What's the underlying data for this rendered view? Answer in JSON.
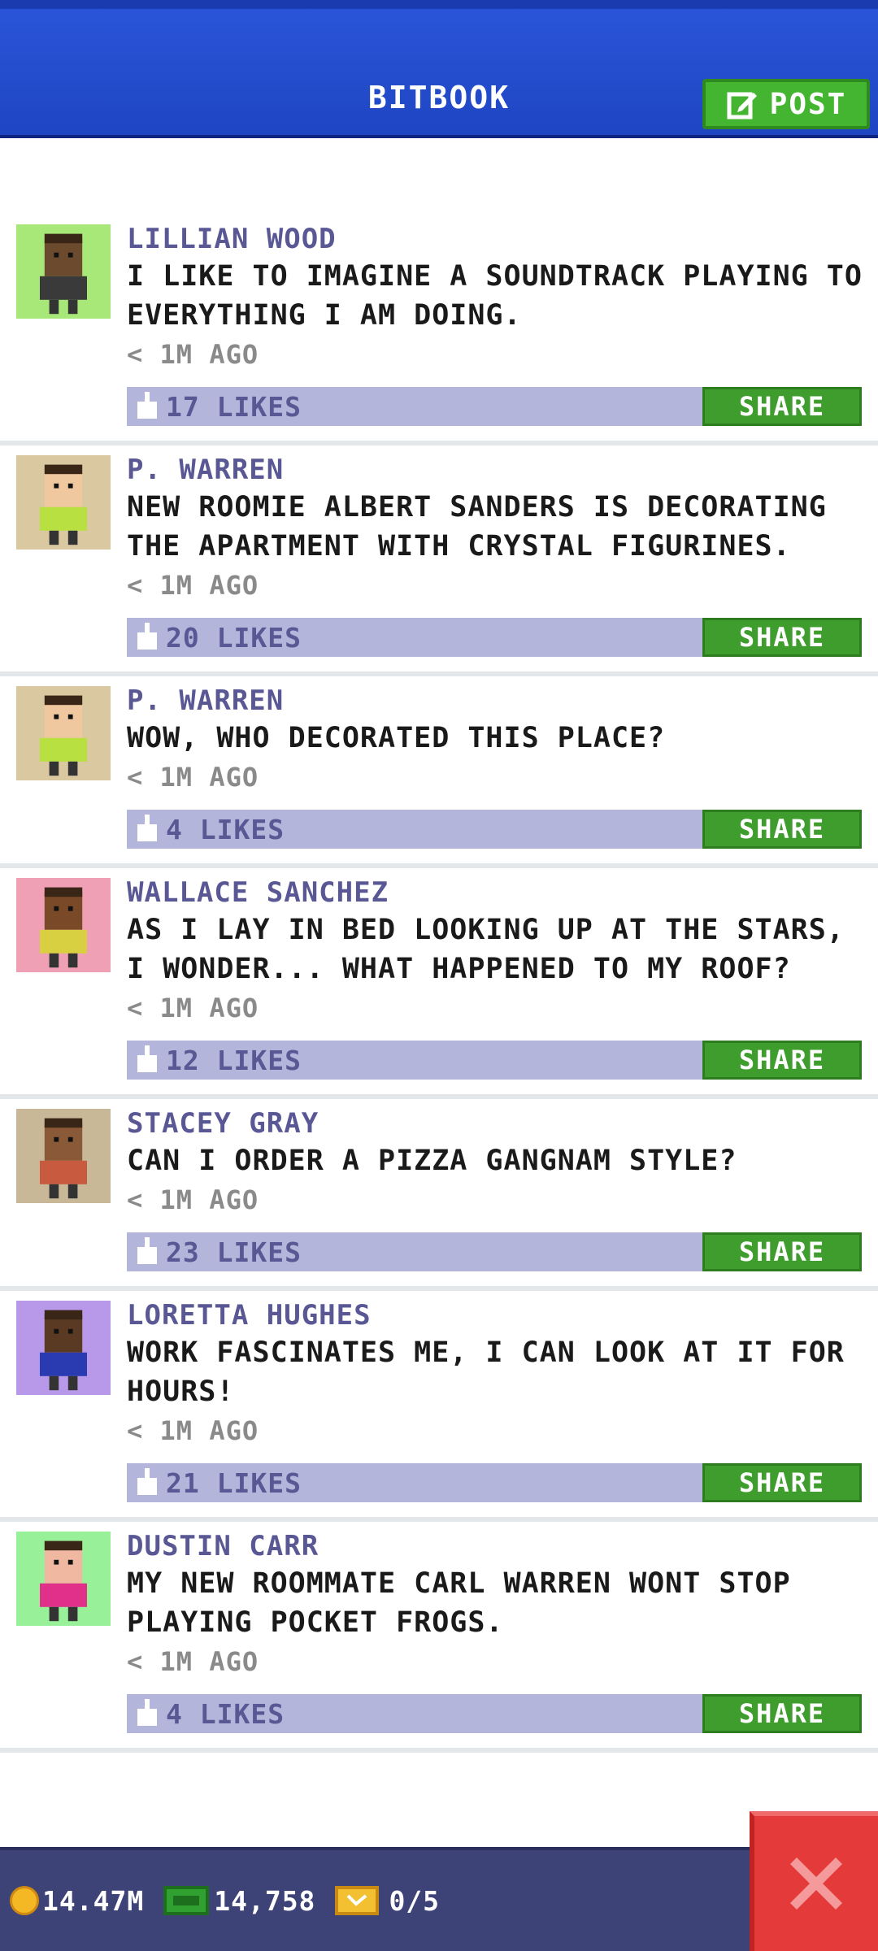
{
  "header": {
    "title": "BITBOOK",
    "post_label": "POST"
  },
  "posts": [
    {
      "author": "LILLIAN WOOD",
      "text": "I LIKE TO IMAGINE A SOUNDTRACK PLAYING TO EVERYTHING I AM DOING.",
      "time": "< 1M AGO",
      "likes": "17 LIKES",
      "share": "SHARE",
      "avatar_bg": "#a8e878",
      "skin": "#6b4a2e",
      "shirt": "#3a3a3a"
    },
    {
      "author": "P. WARREN",
      "text": "NEW ROOMIE ALBERT SANDERS IS DECORATING THE APARTMENT WITH CRYSTAL FIGURINES.",
      "time": "< 1M AGO",
      "likes": "20 LIKES",
      "share": "SHARE",
      "avatar_bg": "#d9c8a0",
      "skin": "#f0c8a0",
      "shirt": "#b8e040"
    },
    {
      "author": "P. WARREN",
      "text": "WOW, WHO DECORATED THIS PLACE?",
      "time": "< 1M AGO",
      "likes": "4 LIKES",
      "share": "SHARE",
      "avatar_bg": "#d9c8a0",
      "skin": "#f0c8a0",
      "shirt": "#b8e040"
    },
    {
      "author": "WALLACE SANCHEZ",
      "text": "AS I LAY IN BED LOOKING UP AT THE STARS, I WONDER... WHAT HAPPENED TO MY ROOF?",
      "time": "< 1M AGO",
      "likes": "12 LIKES",
      "share": "SHARE",
      "avatar_bg": "#f0a0b4",
      "skin": "#7a4a28",
      "shirt": "#d8d040"
    },
    {
      "author": "STACEY GRAY",
      "text": "CAN I ORDER A PIZZA GANGNAM STYLE?",
      "time": "< 1M AGO",
      "likes": "23 LIKES",
      "share": "SHARE",
      "avatar_bg": "#c8b898",
      "skin": "#8a5a38",
      "shirt": "#c85a40"
    },
    {
      "author": "LORETTA HUGHES",
      "text": "WORK FASCINATES ME, I CAN LOOK AT IT FOR HOURS!",
      "time": "< 1M AGO",
      "likes": "21 LIKES",
      "share": "SHARE",
      "avatar_bg": "#b898e8",
      "skin": "#5a3a22",
      "shirt": "#2a3ab0"
    },
    {
      "author": "DUSTIN CARR",
      "text": "MY NEW ROOMMATE CARL WARREN WONT STOP PLAYING POCKET FROGS.",
      "time": "< 1M AGO",
      "likes": "4 LIKES",
      "share": "SHARE",
      "avatar_bg": "#98f098",
      "skin": "#f0b8a0",
      "shirt": "#e0308a"
    }
  ],
  "footer": {
    "coins": "14.47M",
    "cash": "14,758",
    "tickets": "0/5"
  },
  "colors": {
    "accent_green": "#44b530",
    "header_blue": "#1e45c2",
    "close_red": "#e53a3a",
    "likes_bar": "#b3b5da"
  }
}
